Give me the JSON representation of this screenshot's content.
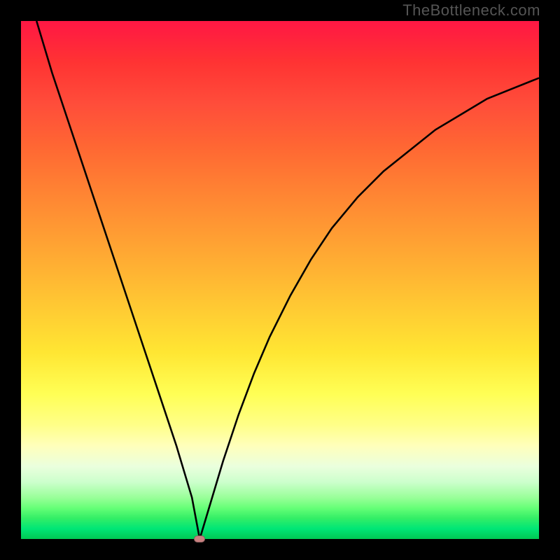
{
  "watermark": "TheBottleneck.com",
  "chart_data": {
    "type": "line",
    "title": "",
    "xlabel": "",
    "ylabel": "",
    "x_range": [
      0,
      100
    ],
    "y_range": [
      0,
      100
    ],
    "grid": false,
    "legend": false,
    "background_gradient": {
      "direction": "vertical",
      "meaning": "bottleneck severity (green=good at y≈0, red=bad at y≈100)",
      "stops": [
        {
          "y": 0,
          "color": "#00c853"
        },
        {
          "y": 10,
          "color": "#66ff77"
        },
        {
          "y": 20,
          "color": "#ffff88"
        },
        {
          "y": 40,
          "color": "#ffcc33"
        },
        {
          "y": 60,
          "color": "#ff8033"
        },
        {
          "y": 80,
          "color": "#ff4d3a"
        },
        {
          "y": 100,
          "color": "#ff1744"
        }
      ]
    },
    "series": [
      {
        "name": "bottleneck-curve",
        "color": "#000000",
        "stroke_width": 2.6,
        "x": [
          3,
          6,
          9,
          12,
          15,
          18,
          21,
          24,
          27,
          30,
          33,
          34.5,
          36,
          39,
          42,
          45,
          48,
          52,
          56,
          60,
          65,
          70,
          75,
          80,
          85,
          90,
          95,
          100
        ],
        "y": [
          100,
          90,
          81,
          72,
          63,
          54,
          45,
          36,
          27,
          18,
          8,
          0,
          5,
          15,
          24,
          32,
          39,
          47,
          54,
          60,
          66,
          71,
          75,
          79,
          82,
          85,
          87,
          89
        ]
      }
    ],
    "marker": {
      "name": "optimal-point",
      "x": 34.5,
      "y": 0,
      "color": "#c98080"
    }
  }
}
